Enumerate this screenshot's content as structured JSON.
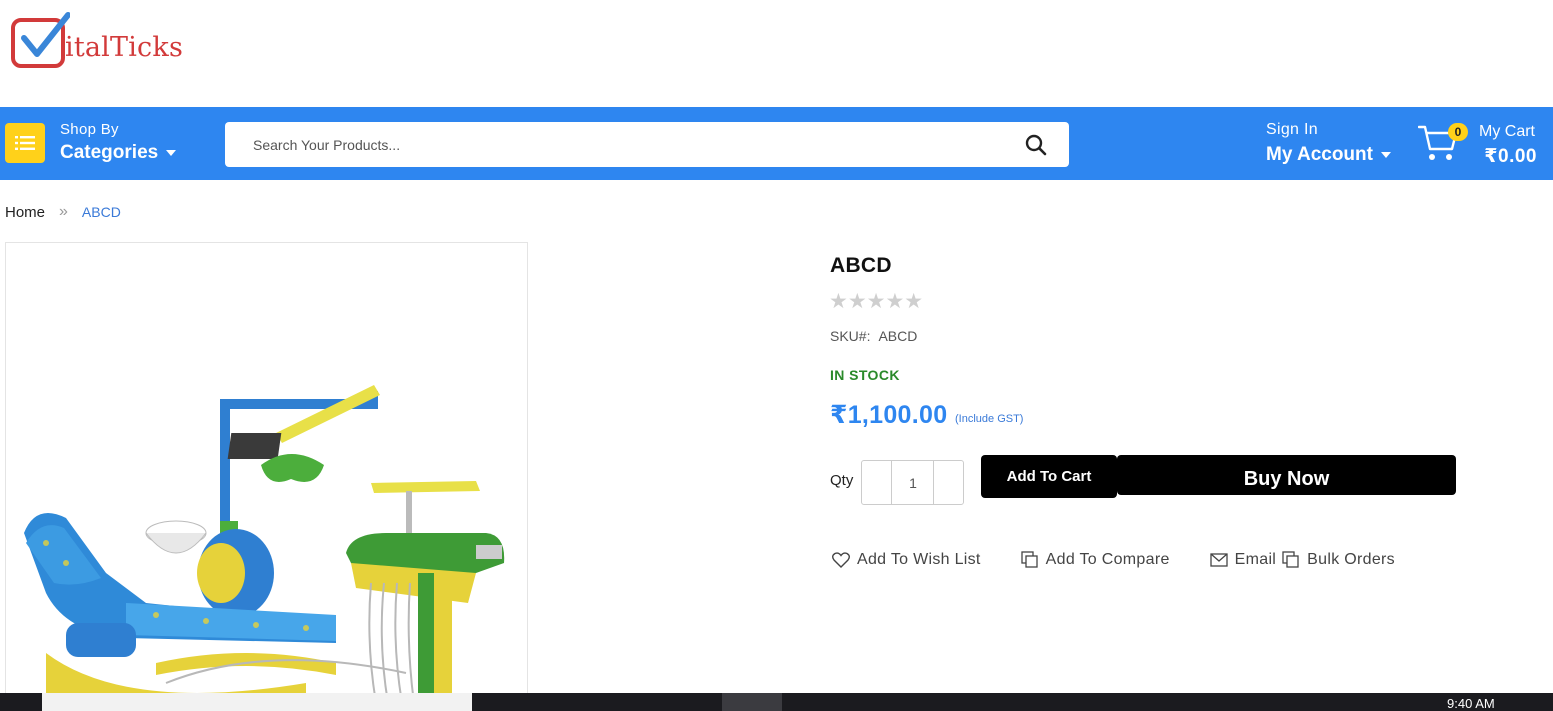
{
  "logo": {
    "text": "italTicks"
  },
  "nav": {
    "shop_by": "Shop By",
    "categories": "Categories",
    "search_placeholder": "Search Your Products...",
    "sign_in": "Sign In",
    "my_account": "My Account",
    "cart_count": "0",
    "my_cart": "My Cart",
    "cart_total": "₹0.00"
  },
  "breadcrumb": {
    "home": "Home",
    "current": "ABCD"
  },
  "product": {
    "title": "ABCD",
    "stars": "★★★★★",
    "sku_label": "SKU#:",
    "sku_value": "ABCD",
    "stock": "IN STOCK",
    "price": "₹1,100.00",
    "gst_note": "(Include GST)",
    "qty_label": "Qty",
    "qty_value": "1",
    "add_to_cart": "Add To Cart",
    "buy_now": "Buy Now"
  },
  "actions": {
    "wishlist": "Add To Wish List",
    "compare": "Add To Compare",
    "email": "Email",
    "bulk": "Bulk Orders"
  },
  "taskbar": {
    "time": "9:40 AM"
  },
  "colors": {
    "nav_blue": "#2e86f0",
    "menu_yellow": "#ffd11a",
    "stock_green": "#2a8a2a",
    "logo_red": "#d23a3a",
    "logo_check": "#3a86d8"
  }
}
